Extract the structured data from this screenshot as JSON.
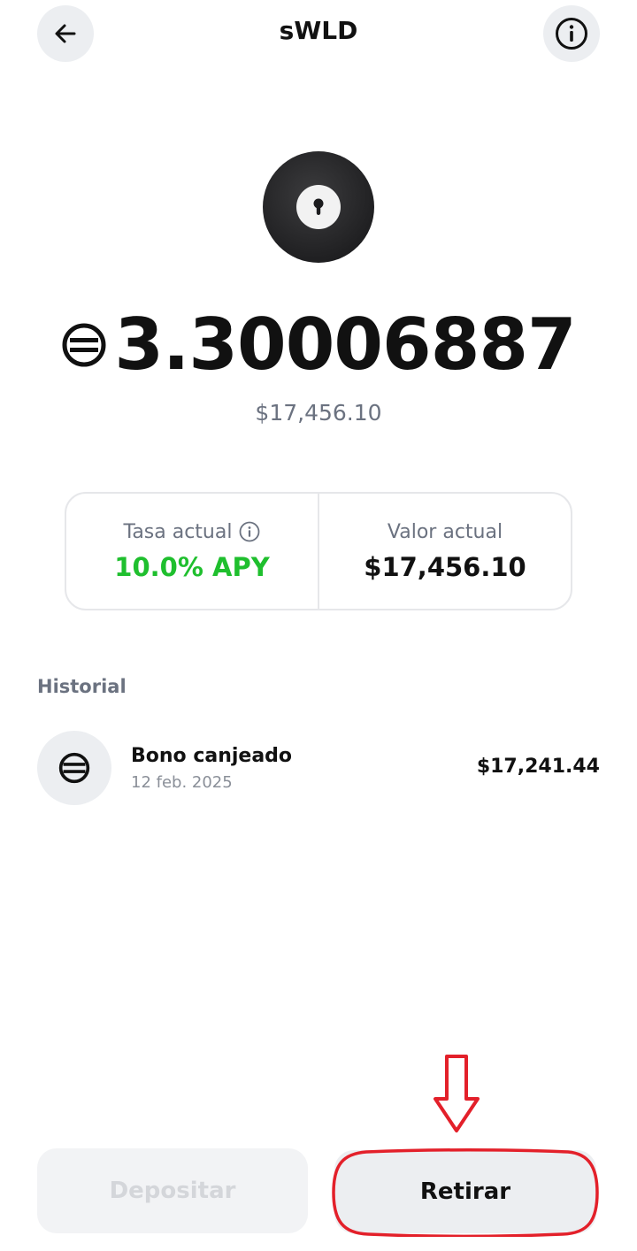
{
  "header": {
    "title": "sWLD",
    "back_icon": "arrow-left-icon",
    "info_icon": "info-icon"
  },
  "token": {
    "logo_icon": "keyhole-lock-icon",
    "currency_icon": "worldcoin-icon",
    "balance": "3.30006887",
    "balance_fiat": "$17,456.10"
  },
  "stats": {
    "rate_label": "Tasa actual",
    "rate_value": "10.0% APY",
    "rate_color": "#1fbf2e",
    "value_label": "Valor actual",
    "value_value": "$17,456.10"
  },
  "history": {
    "title": "Historial",
    "items": [
      {
        "icon": "worldcoin-icon",
        "name": "Bono canjeado",
        "date": "12 feb. 2025",
        "amount": "$17,241.44"
      }
    ]
  },
  "actions": {
    "deposit_label": "Depositar",
    "withdraw_label": "Retirar"
  },
  "annotation": {
    "color": "#e3202a",
    "highlight_icon": "down-arrow-annotation-icon"
  }
}
